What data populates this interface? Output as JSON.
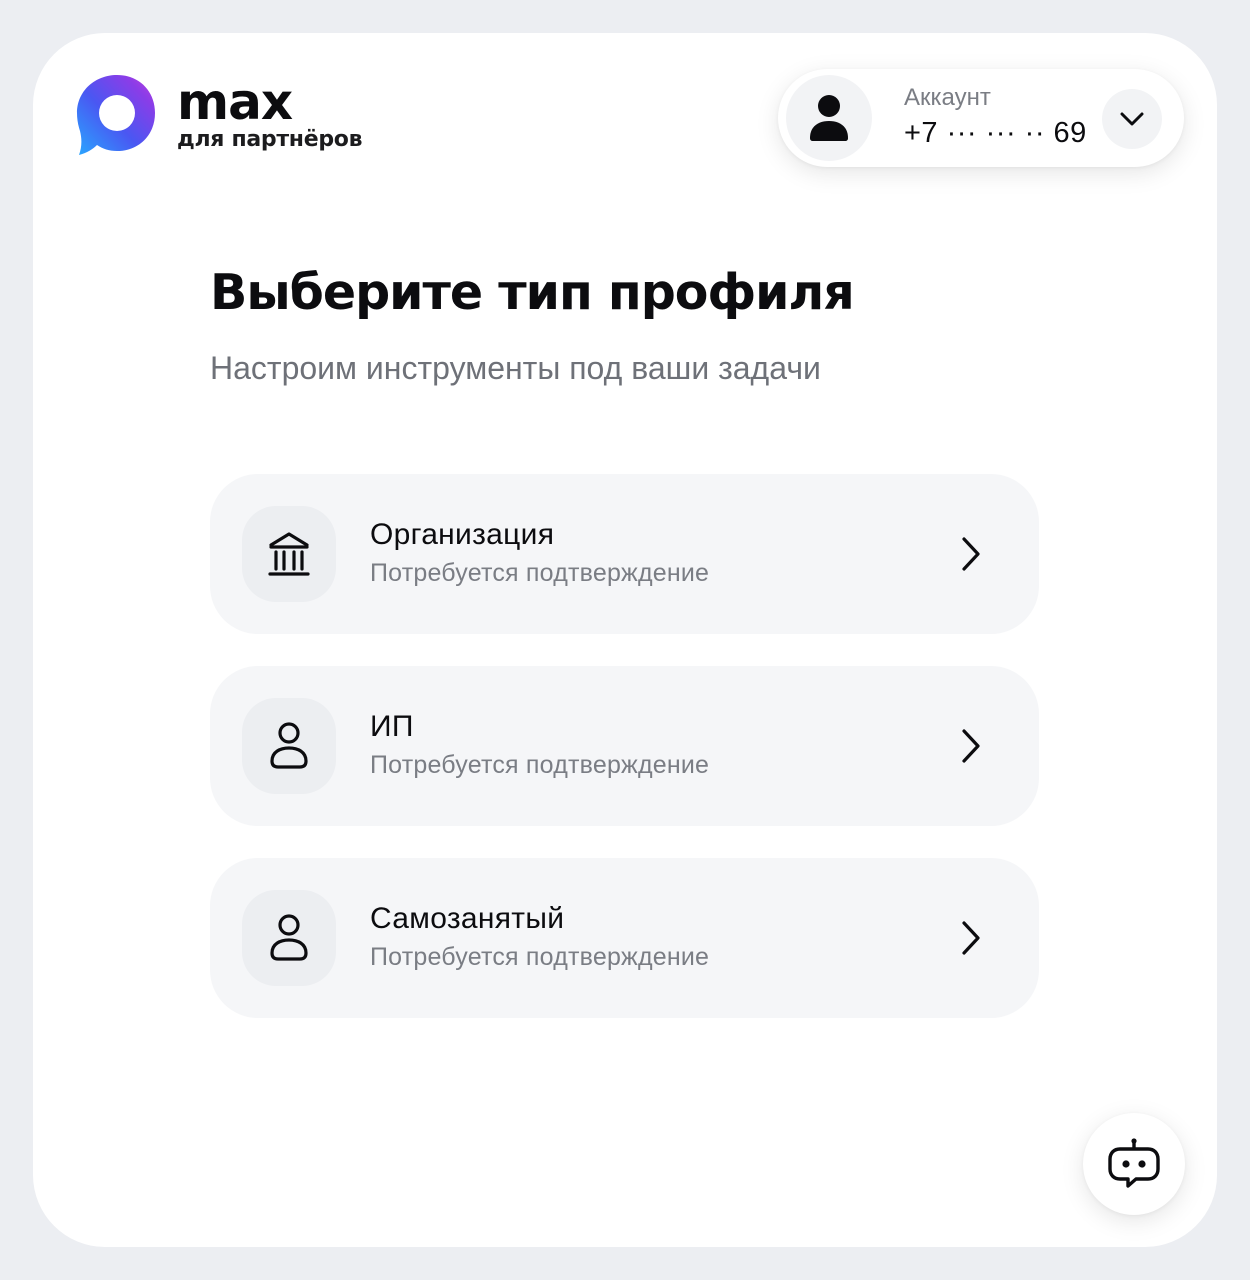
{
  "brand": {
    "name": "max",
    "subtitle": "для партнёров",
    "logo_icon": "max-logo-icon"
  },
  "account": {
    "label": "Аккаунт",
    "phone": "+7 ··· ··· ·· 69",
    "avatar_icon": "user-avatar-icon",
    "toggle_icon": "chevron-down-icon"
  },
  "header": {
    "title": "Выберите тип профиля",
    "subtitle": "Настроим инструменты под ваши задачи"
  },
  "options": [
    {
      "title": "Организация",
      "description": "Потребуется подтверждение",
      "icon": "bank-building-icon"
    },
    {
      "title": "ИП",
      "description": "Потребуется подтверждение",
      "icon": "person-icon"
    },
    {
      "title": "Самозанятый",
      "description": "Потребуется подтверждение",
      "icon": "person-icon"
    }
  ],
  "assistant": {
    "icon": "chatbot-icon"
  },
  "colors": {
    "background": "#eceef2",
    "card": "#ffffff",
    "option_background": "#f5f6f8",
    "text_primary": "#0c0c0f",
    "text_secondary": "#7a7d84",
    "logo_gradient": [
      "#2f6bff",
      "#7a3cf0",
      "#c03fe0"
    ]
  }
}
